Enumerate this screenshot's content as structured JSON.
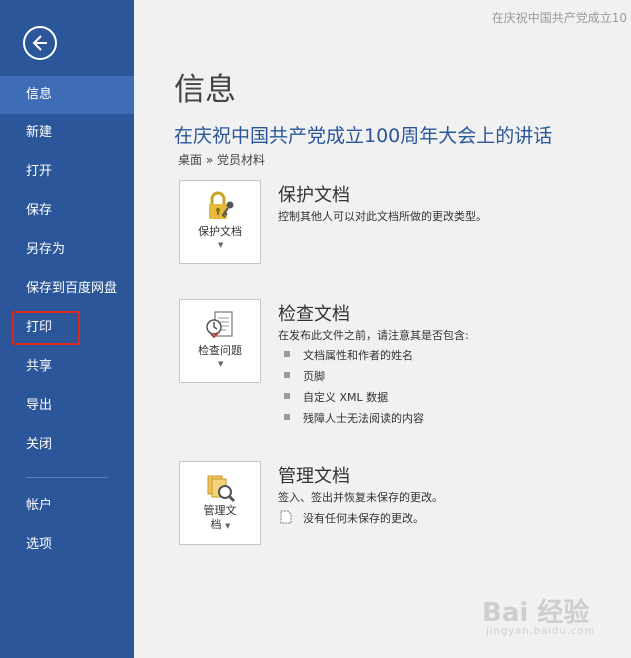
{
  "window": {
    "title": "在庆祝中国共产党成立10"
  },
  "sidebar": {
    "items": [
      {
        "label": "信息"
      },
      {
        "label": "新建"
      },
      {
        "label": "打开"
      },
      {
        "label": "保存"
      },
      {
        "label": "另存为"
      },
      {
        "label": "保存到百度网盘"
      },
      {
        "label": "打印"
      },
      {
        "label": "共享"
      },
      {
        "label": "导出"
      },
      {
        "label": "关闭"
      },
      {
        "label": "帐户"
      },
      {
        "label": "选项"
      }
    ],
    "active_item": "信息",
    "highlighted_item": "打印"
  },
  "main": {
    "page_title": "信息",
    "doc_title": "在庆祝中国共产党成立100周年大会上的讲话",
    "breadcrumb": "桌面 » 党员材料",
    "sections": [
      {
        "button_label": "保护文档",
        "icon": "lock-key-icon",
        "title": "保护文档",
        "description": "控制其他人可以对此文档所做的更改类型。"
      },
      {
        "button_label": "检查问题",
        "icon": "checklist-icon",
        "title": "检查文档",
        "description": "在发布此文件之前，请注意其是否包含:",
        "bullets": [
          "文档属性和作者的姓名",
          "页脚",
          "自定义 XML 数据",
          "残障人士无法阅读的内容"
        ]
      },
      {
        "button_label_line1": "管理文",
        "button_label_line2": "档",
        "icon": "manage-document-icon",
        "title": "管理文档",
        "description": "签入、签出并恢复未保存的更改。",
        "note": "没有任何未保存的更改。"
      }
    ]
  },
  "watermark": {
    "main": "Bai 经验",
    "sub": "jingyan.baidu.com"
  },
  "colors": {
    "sidebar": "#2b579a",
    "active": "#3e6db5",
    "accent": "#2b579a",
    "highlight": "#e02424"
  }
}
